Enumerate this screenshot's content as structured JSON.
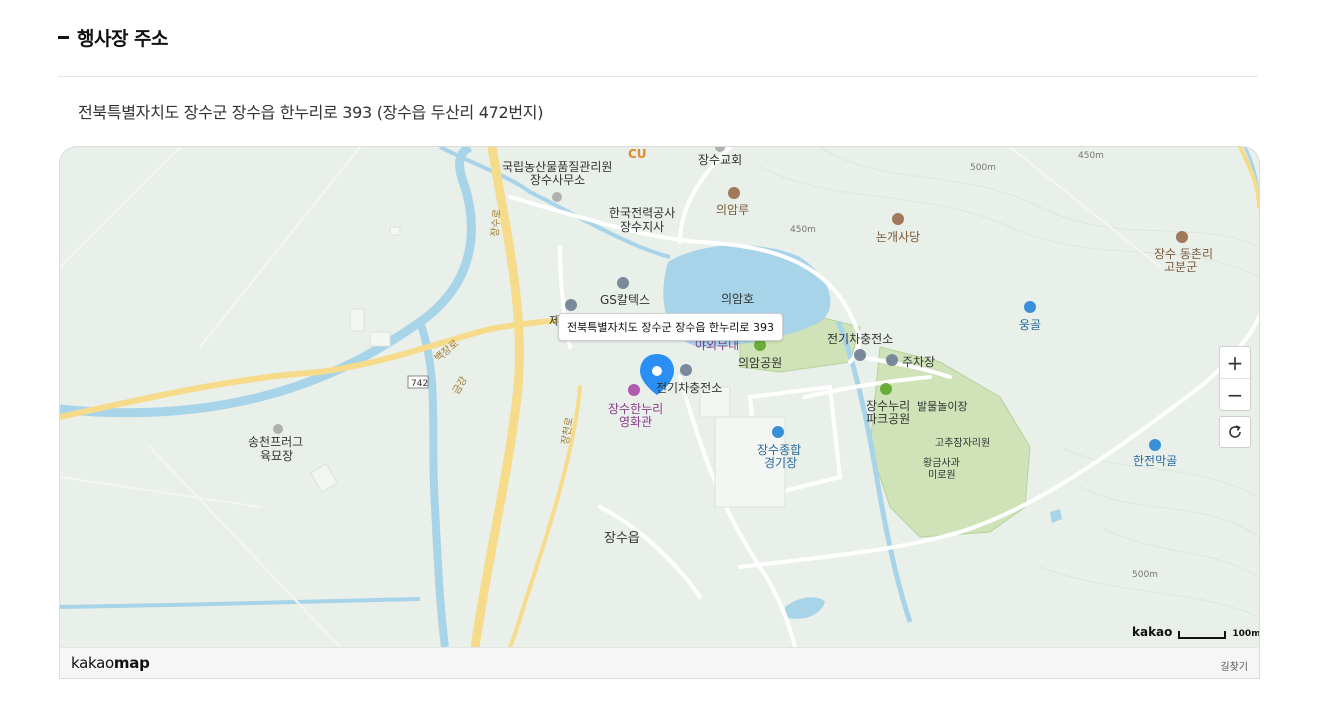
{
  "section": {
    "title": "행사장 주소"
  },
  "address": "전북특별자치도 장수군 장수읍 한누리로 393 (장수읍 두산리 472번지)",
  "map": {
    "tooltip": "전북특별자치도 장수군 장수읍 한누리로 393",
    "labels": {
      "cu": "CU",
      "jangsu_church": "장수교회",
      "naqs_1": "국립농산물품질관리원",
      "naqs_2": "장수사무소",
      "kepco_1": "한국전력공사",
      "kepco_2": "장수지사",
      "uiamru": "의암루",
      "nongae": "논개사당",
      "gs": "GS칼텍스",
      "uiamho": "의암호",
      "outdoor_stage": "야외무대",
      "uiam_park": "의암공원",
      "ev_charger_1": "전기차충전소",
      "ev_charger_2": "전기차충전소",
      "parking": "주차장",
      "cinema_1": "장수한누리",
      "cinema_2": "영화관",
      "stadium_1": "장수종합",
      "stadium_2": "경기장",
      "hannuri_park_1": "장수누리",
      "hannuri_park_2": "파크공원",
      "foot_play": "발물놀이장",
      "pepper": "고추잠자리원",
      "maze_1": "황금사과",
      "maze_2": "미로원",
      "dongchon_1": "장수 동촌리",
      "dongchon_2": "고분군",
      "unggol": "웅골",
      "hanjeon": "한전막골",
      "songcheon_1": "송천프러그",
      "songcheon_2": "육묘장",
      "jangsu_eup": "장수읍",
      "elev_500a": "500m",
      "elev_450a": "450m",
      "elev_450b": "450m",
      "elev_500b": "500m",
      "road_742": "742",
      "road_jangsu": "장수로",
      "road_baekjang": "백장로",
      "road_jangcheon": "장천로",
      "road_geumgang": "금강",
      "road_je": "제"
    },
    "controls": {
      "zoom_in": "+",
      "zoom_out": "−"
    },
    "scale": {
      "brand": "kakao",
      "label": "100m"
    },
    "footer": {
      "logo_light": "kakao",
      "logo_bold": "map",
      "route": "길찾기"
    },
    "colors": {
      "background": "#e9efe9",
      "water": "#a8d4ea",
      "road_major": "#f6dc8a",
      "road_minor": "#ffffff",
      "park": "#cfe2b8",
      "marker": "#2b8ef5"
    }
  }
}
